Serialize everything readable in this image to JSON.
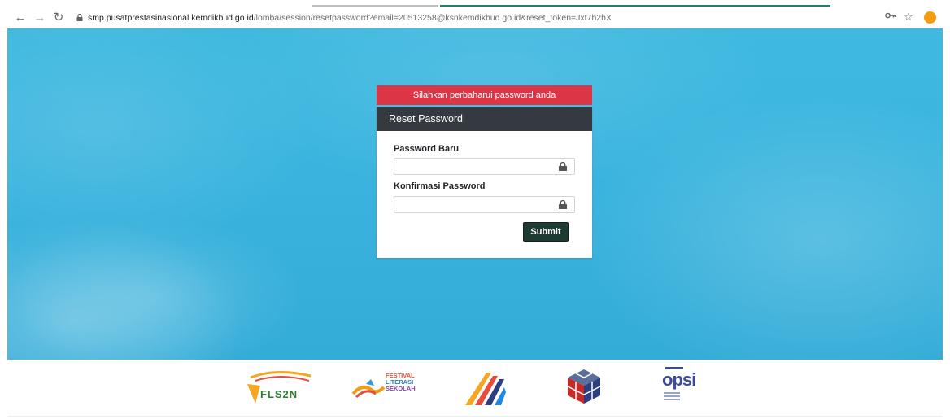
{
  "browser": {
    "url_host": "smp.pusatprestasinasional.kemdikbud.go.id",
    "url_path": "/lomba/session/resetpassword?email=20513258@ksnkemdikbud.go.id&reset_token=Jxt7h2hX",
    "profile_initial": "!"
  },
  "alert": {
    "message": "Silahkan perbaharui password anda"
  },
  "form": {
    "title": "Reset Password",
    "password_label": "Password Baru",
    "password_value": "",
    "confirm_label": "Konfirmasi Password",
    "confirm_value": "",
    "submit_label": "Submit"
  },
  "footer": {
    "logos": [
      {
        "name": "FLS2N",
        "icon": "fls2n-logo"
      },
      {
        "name": "FESTIVAL LITERASI SEKOLAH",
        "icon": "festival-literasi-sekolah-logo"
      },
      {
        "name": "",
        "icon": "stripes-logo"
      },
      {
        "name": "",
        "icon": "cube-logo"
      },
      {
        "name": "OPSI",
        "icon": "opsi-logo"
      }
    ],
    "fls_line1": "FESTIVAL",
    "fls_line2": "LITERASI",
    "fls_line3": "SEKOLAH",
    "fls2n_text": "FLS2N",
    "opsi_text": "opsi"
  },
  "colors": {
    "hero": "#3ab4de",
    "alert": "#dc3545",
    "card_header": "#343a40",
    "submit": "#1d3a33"
  }
}
